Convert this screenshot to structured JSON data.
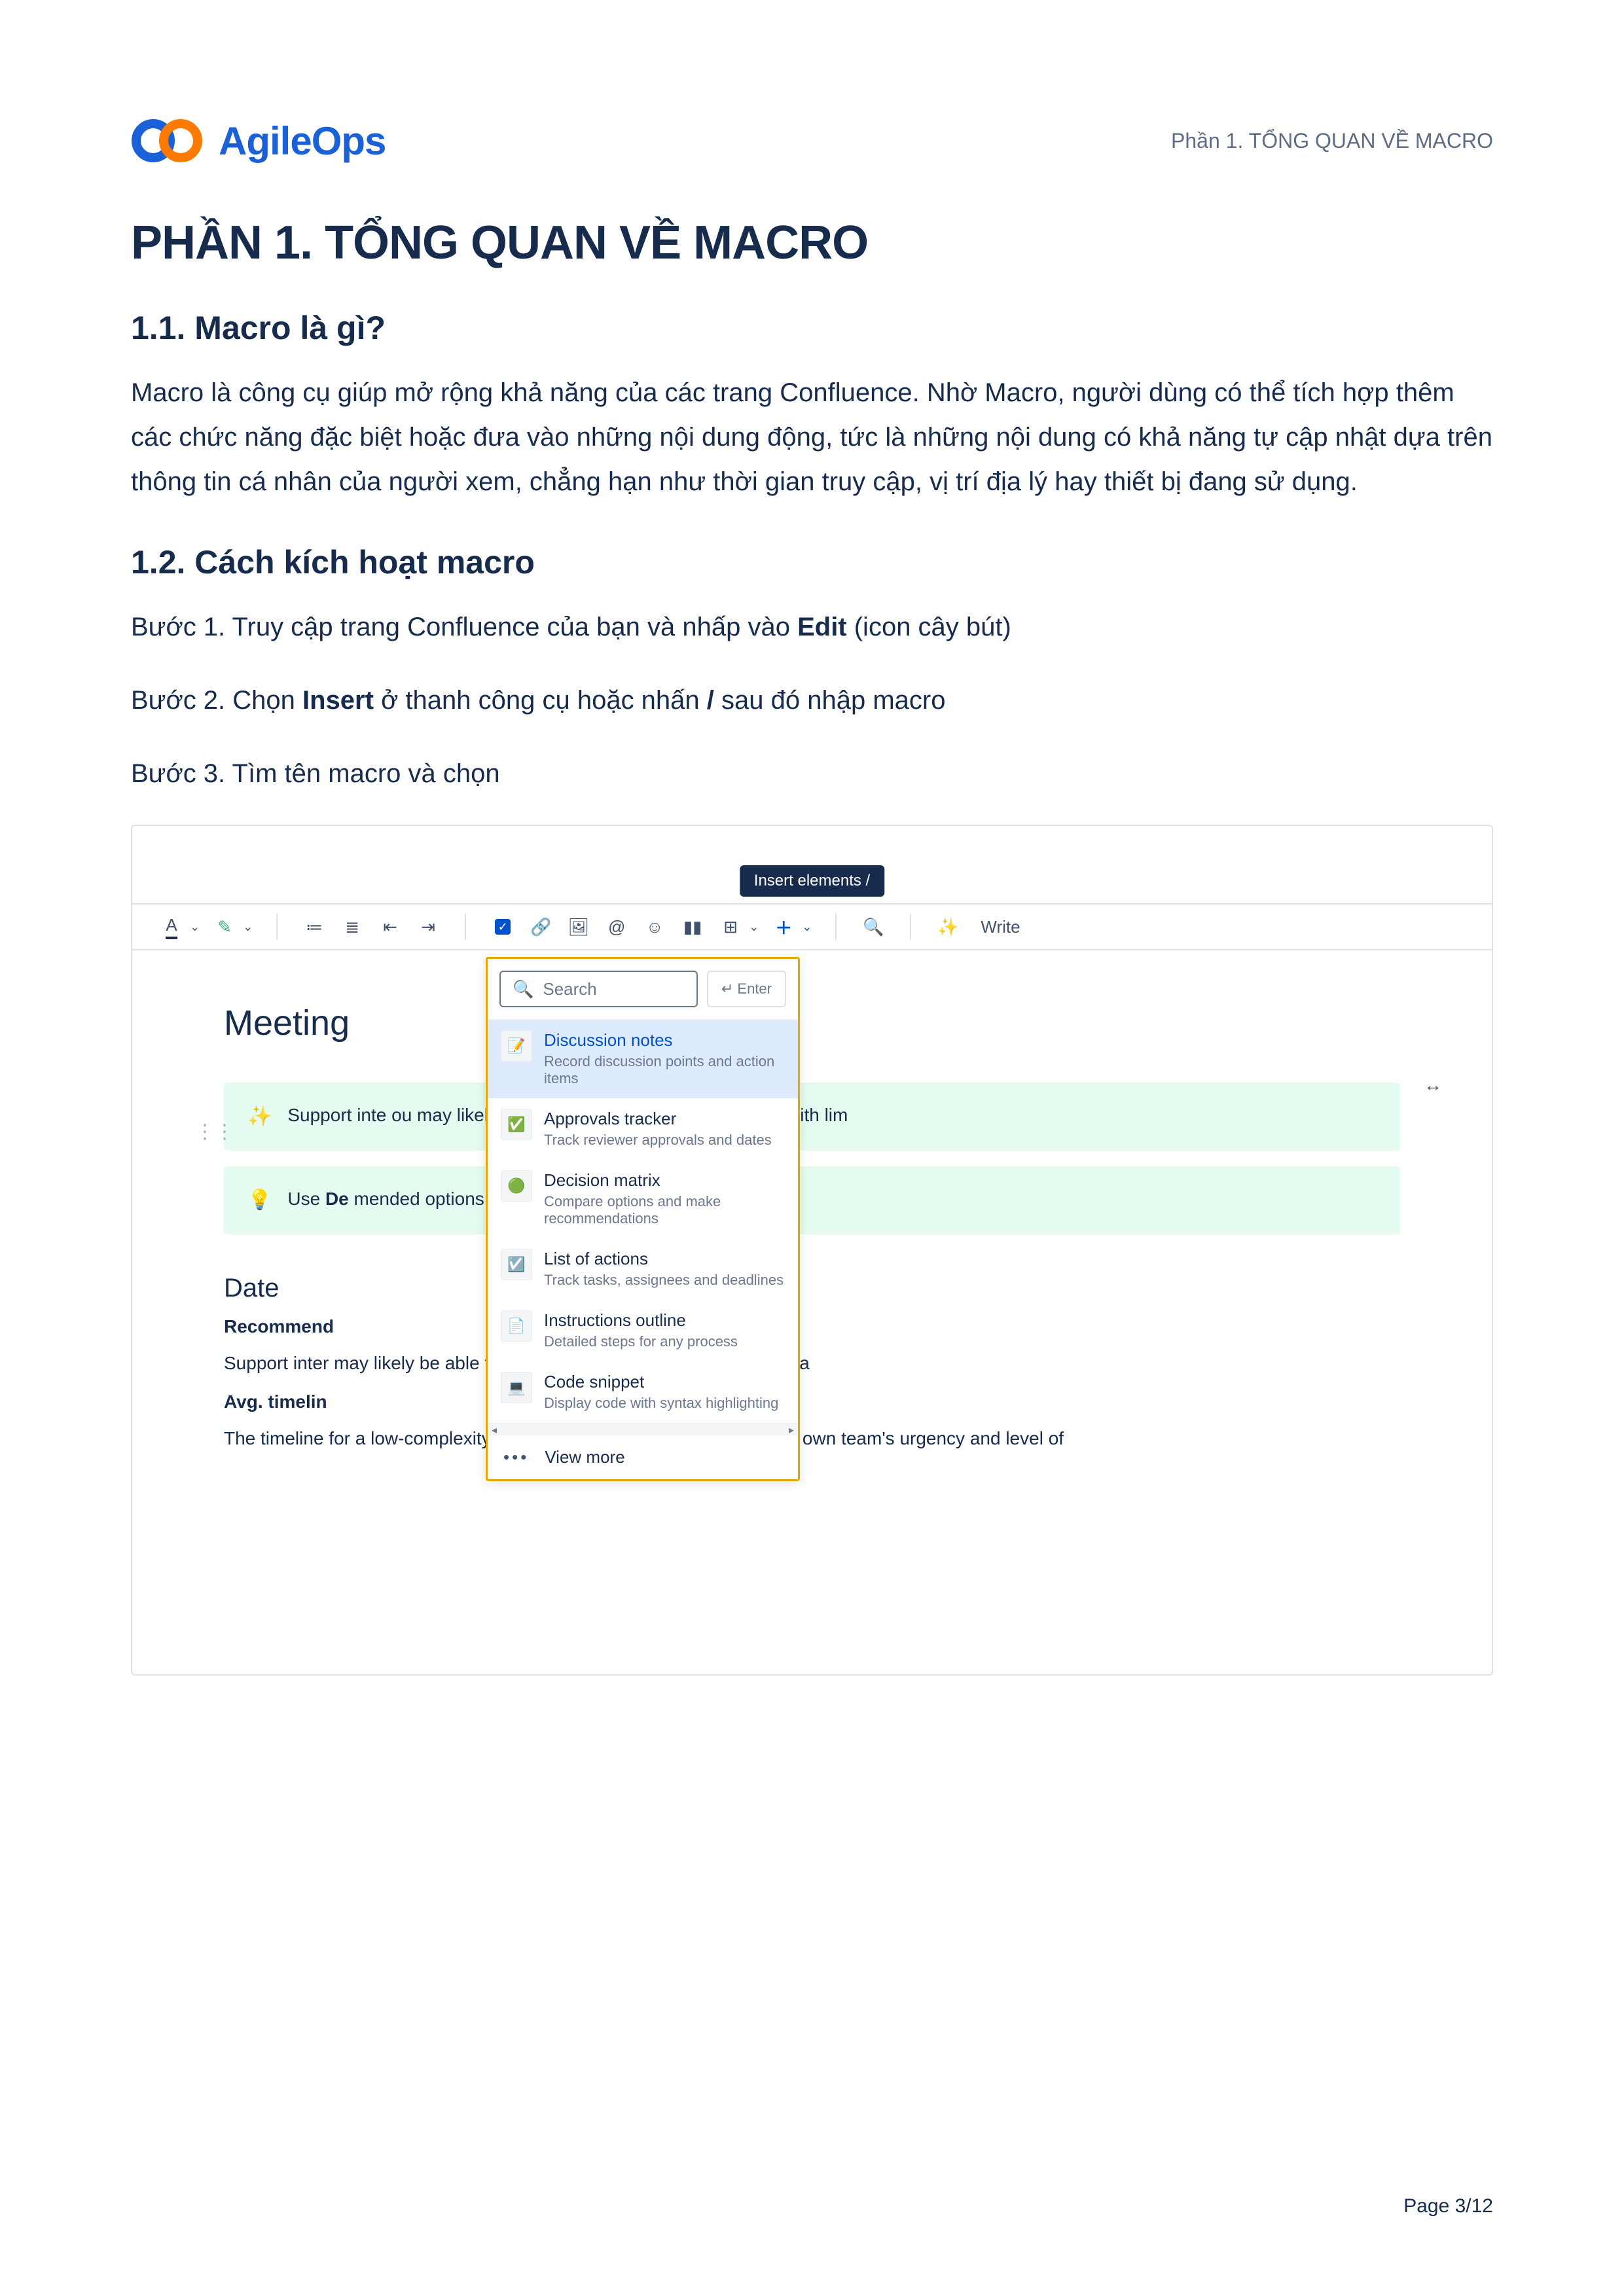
{
  "header": {
    "brand_name": "AgileOps",
    "caption": "Phần 1. TỔNG QUAN VỀ MACRO"
  },
  "title": "PHẦN 1. TỔNG QUAN VỀ MACRO",
  "section_1_1": {
    "heading": "1.1. Macro là gì?",
    "body": "Macro là công cụ giúp mở rộng khả năng của các trang Confluence. Nhờ Macro, người dùng có thể tích hợp thêm các chức năng đặc biệt hoặc đưa vào những nội dung động, tức là những nội dung có khả năng tự cập nhật dựa trên thông tin cá nhân của người xem, chẳng hạn như thời gian truy cập, vị trí địa lý hay thiết bị đang sử dụng."
  },
  "section_1_2": {
    "heading": "1.2. Cách kích hoạt macro",
    "step1_pre": "Bước 1. Truy cập trang Confluence của bạn và nhấp vào ",
    "step1_bold": "Edit",
    "step1_post": " (icon cây bút)",
    "step2_pre": "Bước 2. Chọn ",
    "step2_bold1": "Insert",
    "step2_mid": " ở thanh công cụ hoặc nhấn ",
    "step2_bold2": "/",
    "step2_post": " sau đó nhập macro",
    "step3": "Bước 3. Tìm tên macro và chọn"
  },
  "screenshot": {
    "tooltip": "Insert elements  /",
    "toolbar": {
      "write": "Write"
    },
    "doc": {
      "title": "Meeting",
      "callout1": "Support inte                                                                                          ou may likely be able to complete it on your own with lim",
      "callout2_pre": "Use ",
      "callout2_bold": "De",
      "callout2_post": "                                                                                    mended options.",
      "h3": "Date",
      "bold1": "Recommend",
      "p1": "Support inter                                                                                              may likely be able to complete it on your own with limited a",
      "bold2": "Avg. timelin",
      "p2": "The timeline for a low-complexity migration is often determined by your own team's urgency and level of"
    },
    "dropdown": {
      "search_placeholder": "Search",
      "enter_label": "↵ Enter",
      "more_label": "View more",
      "items": [
        {
          "title": "Discussion notes",
          "desc": "Record discussion points and action items",
          "icon": "note-icon",
          "highlight": true
        },
        {
          "title": "Approvals tracker",
          "desc": "Track reviewer approvals and dates",
          "icon": "check-icon",
          "highlight": false
        },
        {
          "title": "Decision matrix",
          "desc": "Compare options and make recommendations",
          "icon": "matrix-icon",
          "highlight": false
        },
        {
          "title": "List of actions",
          "desc": "Track tasks, assignees and deadlines",
          "icon": "list-icon",
          "highlight": false
        },
        {
          "title": "Instructions outline",
          "desc": "Detailed steps for any process",
          "icon": "outline-icon",
          "highlight": false
        },
        {
          "title": "Code snippet",
          "desc": "Display code with syntax highlighting",
          "icon": "code-icon",
          "highlight": false
        }
      ]
    }
  },
  "footer": {
    "page_label": "Page 3/12"
  }
}
